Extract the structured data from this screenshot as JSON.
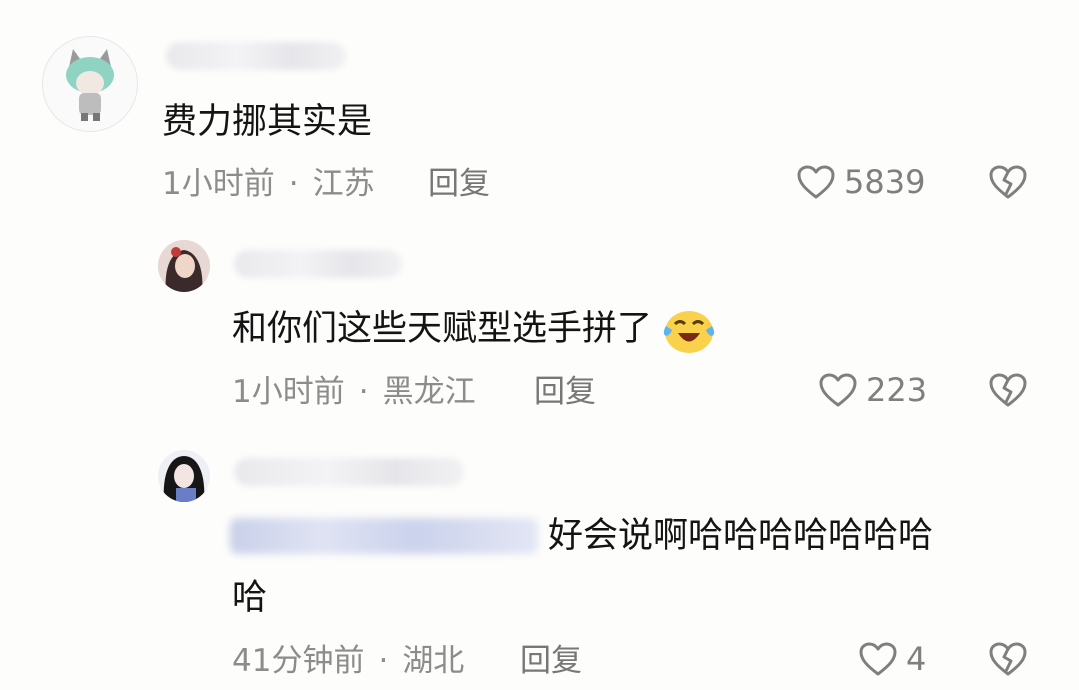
{
  "comments": [
    {
      "text": "费力挪其实是",
      "time": "1小时前",
      "location": "江苏",
      "reply_label": "回复",
      "likes": "5839"
    },
    {
      "text": "和你们这些天赋型选手拼了",
      "emoji": "crying-laughing-emoji",
      "time": "1小时前",
      "location": "黑龙江",
      "reply_label": "回复",
      "likes": "223"
    },
    {
      "text_line1": "好会说啊哈哈哈哈哈哈哈",
      "text_line2": "哈",
      "time": "41分钟前",
      "location": "湖北",
      "reply_label": "回复",
      "likes": "4"
    }
  ],
  "colors": {
    "meta": "#8c8c8c",
    "text": "#141414",
    "background": "#fdfdfb"
  },
  "icons": {
    "like": "heart-outline-icon",
    "dislike": "broken-heart-icon"
  }
}
